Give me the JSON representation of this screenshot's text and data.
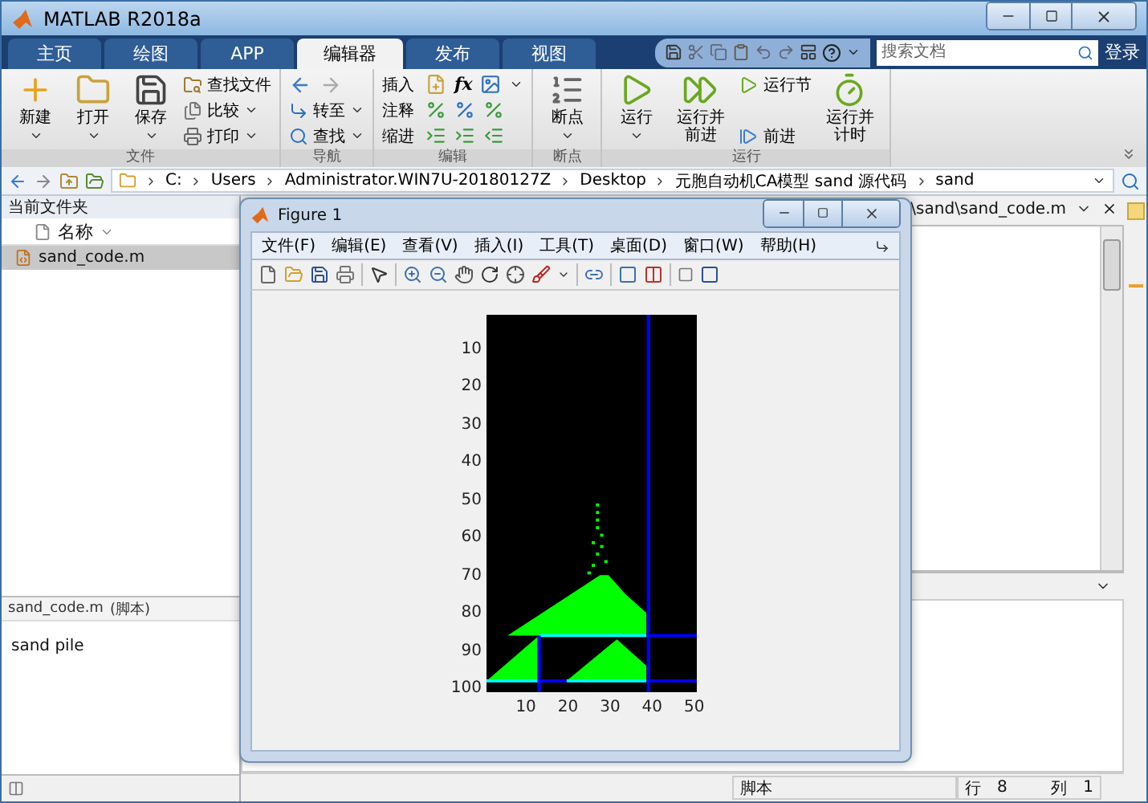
{
  "window": {
    "title": "MATLAB R2018a"
  },
  "tabs": [
    {
      "label": "主页",
      "selected": false
    },
    {
      "label": "绘图",
      "selected": false
    },
    {
      "label": "APP",
      "selected": false
    },
    {
      "label": "编辑器",
      "selected": true
    },
    {
      "label": "发布",
      "selected": false
    },
    {
      "label": "视图",
      "selected": false
    }
  ],
  "search": {
    "placeholder": "搜索文档"
  },
  "login": "登录",
  "ribbon": {
    "groups": [
      {
        "kind": "file",
        "label": "文件",
        "items": [
          {
            "kind": "large",
            "label": "新建",
            "menu": true
          },
          {
            "kind": "large",
            "label": "打开",
            "menu": true
          },
          {
            "kind": "large",
            "label": "保存",
            "menu": true
          },
          {
            "kind": "small",
            "label": "查找文件",
            "menu": false
          },
          {
            "kind": "small",
            "label": "比较",
            "menu": true
          },
          {
            "kind": "small",
            "label": "打印",
            "menu": true
          }
        ]
      },
      {
        "kind": "navigate",
        "label": "导航",
        "items": [
          {
            "kind": "arrows"
          },
          {
            "kind": "small",
            "label": "转至",
            "menu": true
          },
          {
            "kind": "small",
            "label": "查找",
            "menu": true
          }
        ]
      },
      {
        "kind": "edit",
        "label": "编辑",
        "items": [
          {
            "kind": "tools",
            "label": "插入",
            "glyph": "fx",
            "menu": true
          },
          {
            "kind": "tools",
            "label": "注释",
            "menu": false
          },
          {
            "kind": "tools",
            "label": "缩进",
            "menu": false
          }
        ]
      },
      {
        "kind": "breakpoint",
        "label": "断点",
        "items": [
          {
            "kind": "large",
            "label": "断点",
            "menu": true
          }
        ]
      },
      {
        "kind": "run",
        "label": "运行",
        "items": [
          {
            "kind": "large",
            "label": "运行",
            "menu": true
          },
          {
            "kind": "large",
            "label": "运行并前进",
            "menu": false
          },
          {
            "kind": "small",
            "label": "运行节",
            "menu": false
          },
          {
            "kind": "small",
            "label": "前进",
            "menu": false
          },
          {
            "kind": "large",
            "label": "运行并计时",
            "menu": false
          }
        ]
      }
    ]
  },
  "address": {
    "crumbs": [
      "C:",
      "Users",
      "Administrator.WIN7U-20180127Z",
      "Desktop",
      "元胞自动机CA模型 sand 源代码",
      "sand"
    ]
  },
  "folder": {
    "title": "当前文件夹",
    "column": "名称",
    "files": [
      {
        "name": "sand_code.m",
        "selected": true
      }
    ],
    "details": {
      "name": "sand_code.m",
      "type": "(脚本)",
      "description": "sand pile"
    }
  },
  "editor": {
    "path": "\\sand\\sand_code.m"
  },
  "figure": {
    "title": "Figure 1",
    "menus": [
      "文件(F)",
      "编辑(E)",
      "查看(V)",
      "插入(I)",
      "工具(T)",
      "桌面(D)",
      "窗口(W)",
      "帮助(H)"
    ],
    "yticks": [
      "10",
      "20",
      "30",
      "40",
      "50",
      "60",
      "70",
      "80",
      "90",
      "100"
    ],
    "xticks": [
      "10",
      "20",
      "30",
      "40",
      "50"
    ]
  },
  "status": {
    "mode": "脚本",
    "row_label": "行",
    "row": "8",
    "col_label": "列",
    "col": "1"
  }
}
